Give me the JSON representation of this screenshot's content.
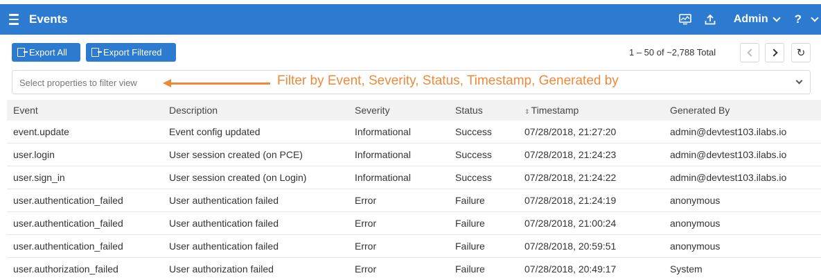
{
  "header": {
    "title": "Events",
    "user_label": "Admin",
    "help_label": "?",
    "icons": [
      "menu-icon",
      "monitor-icon",
      "upload-icon",
      "chevron-down-icon"
    ]
  },
  "toolbar": {
    "export_all_label": "Export All",
    "export_filtered_label": "Export Filtered",
    "pagination_text": "1 – 50 of ~2,788 Total",
    "refresh_glyph": "↻"
  },
  "filter": {
    "placeholder": "Select properties to filter view",
    "annotation": "Filter by Event, Severity, Status, Timestamp, Generated by"
  },
  "table": {
    "headers": [
      "Event",
      "Description",
      "Severity",
      "Status",
      "Timestamp",
      "Generated By"
    ],
    "sorted_column_glyph": "⇕",
    "rows": [
      [
        "event.update",
        "Event config updated",
        "Informational",
        "Success",
        "07/28/2018, 21:27:20",
        "admin@devtest103.ilabs.io"
      ],
      [
        "user.login",
        "User session created (on PCE)",
        "Informational",
        "Success",
        "07/28/2018, 21:24:23",
        "admin@devtest103.ilabs.io"
      ],
      [
        "user.sign_in",
        "User session created (on Login)",
        "Informational",
        "Success",
        "07/28/2018, 21:24:22",
        "admin@devtest103.ilabs.io"
      ],
      [
        "user.authentication_failed",
        "User authentication failed",
        "Error",
        "Failure",
        "07/28/2018, 21:24:19",
        "anonymous"
      ],
      [
        "user.authentication_failed",
        "User authentication failed",
        "Error",
        "Failure",
        "07/28/2018, 21:00:24",
        "anonymous"
      ],
      [
        "user.authentication_failed",
        "User authentication failed",
        "Error",
        "Failure",
        "07/28/2018, 20:59:51",
        "anonymous"
      ],
      [
        "user.authorization_failed",
        "User authorization failed",
        "Error",
        "Failure",
        "07/28/2018, 20:49:17",
        "System"
      ]
    ]
  },
  "colors": {
    "header_bg": "#2c7bd0",
    "button_bg": "#2c7bd0",
    "annotation": "#ed8a3a"
  }
}
